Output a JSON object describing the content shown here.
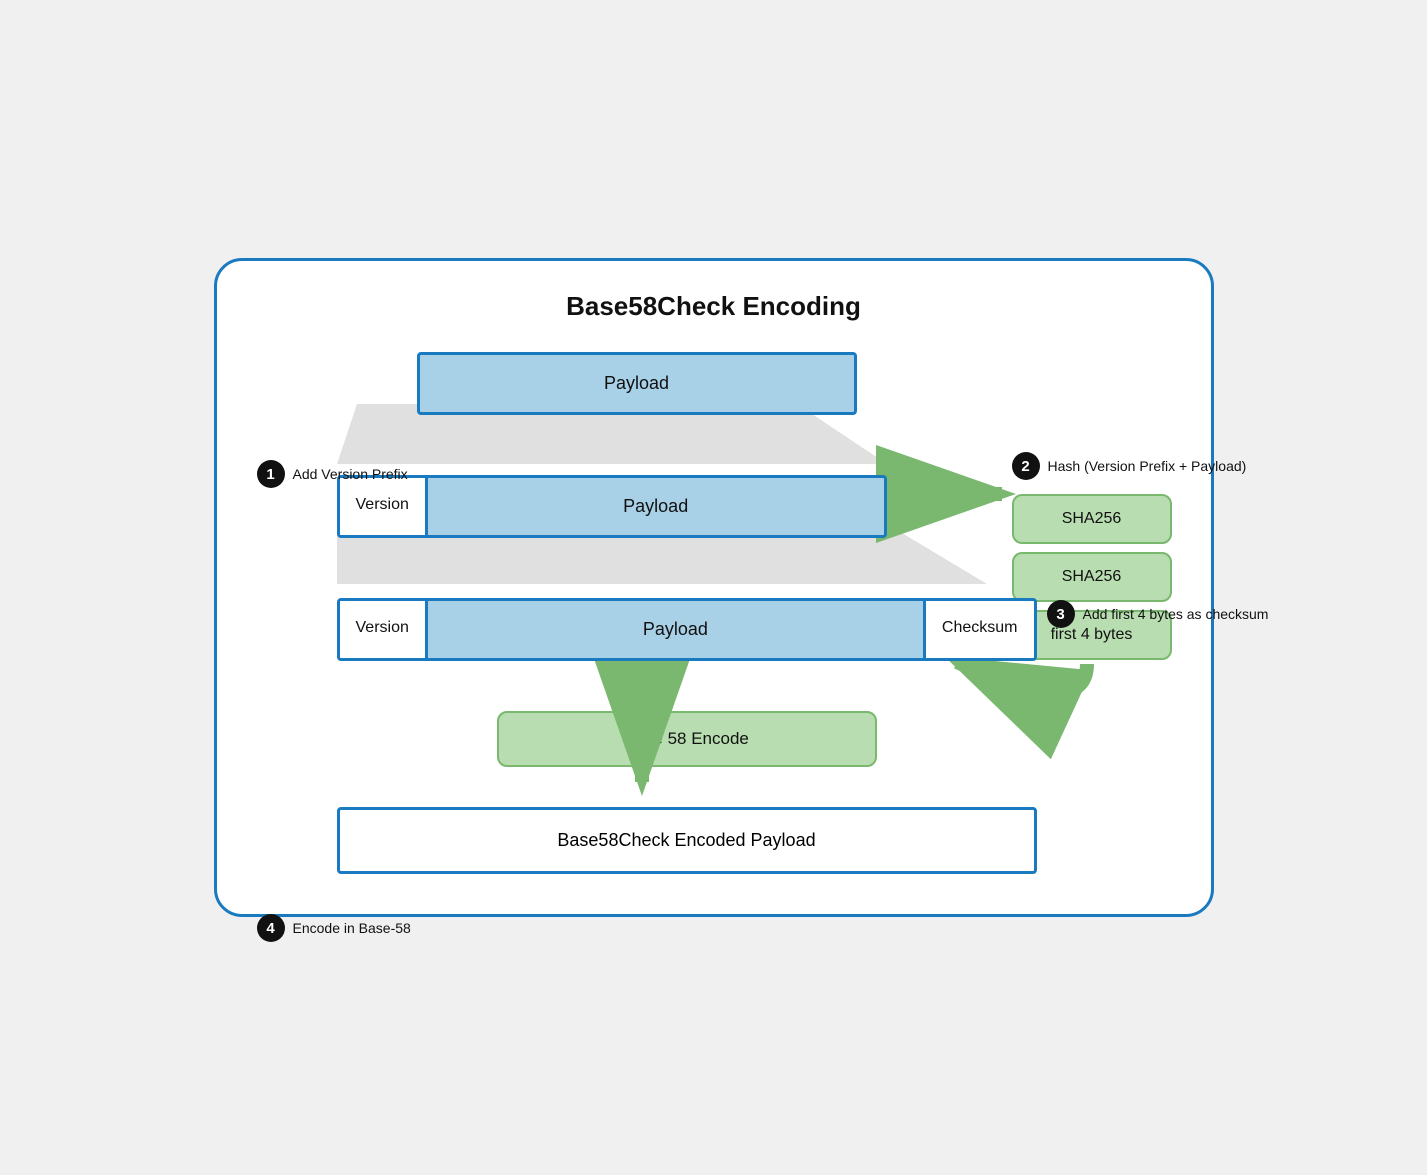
{
  "title": "Base58Check Encoding",
  "step1": {
    "number": "1",
    "label": "Add Version Prefix"
  },
  "step2": {
    "number": "2",
    "label": "Hash (Version Prefix + Payload)"
  },
  "step3": {
    "number": "3",
    "label": "Add first 4 bytes as checksum"
  },
  "step4": {
    "number": "4",
    "label": "Encode in Base-58"
  },
  "boxes": {
    "payload": "Payload",
    "version": "Version",
    "checksum": "Checksum",
    "sha256_1": "SHA256",
    "sha256_2": "SHA256",
    "first4bytes": "first 4 bytes",
    "base58encode": "Base 58 Encode",
    "finalPayload": "Base58Check Encoded Payload"
  }
}
